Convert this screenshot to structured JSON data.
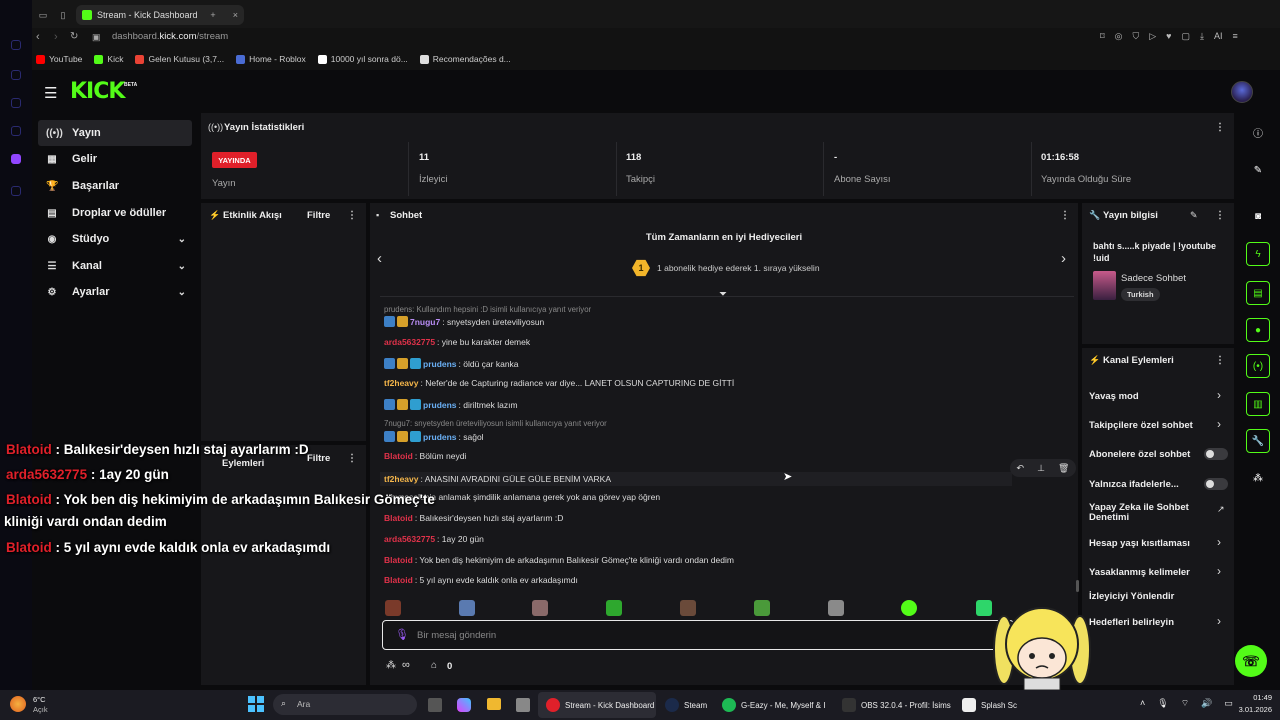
{
  "browser": {
    "tab_title": "Stream - Kick Dashboard",
    "url_prefix": "dashboard.",
    "url_domain": "kick.com",
    "url_path": "/stream",
    "ai_label": "AI",
    "bookmarks": [
      {
        "label": "YouTube",
        "icon": "youtube-icon",
        "color": "#ff0000"
      },
      {
        "label": "Kick",
        "icon": "kick-icon",
        "color": "#53fc18"
      },
      {
        "label": "Gelen Kutusu (3,7...",
        "icon": "gmail-icon",
        "color": "#ea4335"
      },
      {
        "label": "Home - Roblox",
        "icon": "roblox-icon",
        "color": "#4a6cd4"
      },
      {
        "label": "10000 yıl sonra dö...",
        "icon": "google-icon",
        "color": "#ffffff"
      },
      {
        "label": "Recomendações d...",
        "icon": "tiktok-icon",
        "color": "#dddddd"
      }
    ]
  },
  "brand": {
    "logo": "KICK",
    "beta": "BETA",
    "accent": "#53fc18"
  },
  "sidebar": {
    "items": [
      {
        "label": "Yayın",
        "icon": "broadcast-icon",
        "glyph": "((•))",
        "active": true
      },
      {
        "label": "Gelir",
        "icon": "revenue-icon",
        "glyph": "▦"
      },
      {
        "label": "Başarılar",
        "icon": "trophy-icon",
        "glyph": "🏆"
      },
      {
        "label": "Droplar ve ödüller",
        "icon": "gift-icon",
        "glyph": "▤"
      },
      {
        "label": "Stüdyo",
        "icon": "studio-icon",
        "glyph": "◉",
        "expandable": true
      },
      {
        "label": "Kanal",
        "icon": "channel-icon",
        "glyph": "☰",
        "expandable": true
      },
      {
        "label": "Ayarlar",
        "icon": "gear-icon",
        "glyph": "⚙",
        "expandable": true
      }
    ]
  },
  "stats": {
    "title": "Yayın İstatistikleri",
    "live_badge": "YAYINDA",
    "live_label": "Yayın",
    "viewers_value": "11",
    "viewers_label": "İzleyici",
    "followers_value": "118",
    "followers_label": "Takipçi",
    "subs_value": "-",
    "subs_label": "Abone Sayısı",
    "uptime_value": "01:16:58",
    "uptime_label": "Yayında Olduğu Süre"
  },
  "activity": {
    "title": "Etkinlik Akışı",
    "filter": "Filtre"
  },
  "mod_actions": {
    "title": "Eylemleri",
    "filter": "Filtre"
  },
  "chat": {
    "title": "Sohbet",
    "top_gifters_title": "Tüm Zamanların en iyi Hediyecileri",
    "top_gifters_rank": "1",
    "top_gifters_subtitle": "1 abonelik hediye ederek 1. sıraya yükselin",
    "reply1": "prudens: Kullandım hepsini :D isimli kullanıcıya yanıt veriyor",
    "reply2": "7nugu7: snyetsyden üreteviliyosun isimli kullanıcıya yanıt veriyor",
    "messages": [
      {
        "user": "7nugu7",
        "color": "#b98df5",
        "text": ": snyetsyden üreteviliyosun"
      },
      {
        "user": "arda5632775",
        "color": "#e0324a",
        "text": ": yine bu karakter demek"
      },
      {
        "user": "prudens",
        "color": "#6ab0f5",
        "text": ": öldü çar kanka"
      },
      {
        "user": "tf2heavy",
        "color": "#f5b64a",
        "text": ": Nefer'de de Capturing radiance var diye... LANET OLSUN CAPTURING DE GİTTİ"
      },
      {
        "user": "prudens",
        "color": "#6ab0f5",
        "text": ": diriltmek lazım"
      },
      {
        "user": "prudens",
        "color": "#6ab0f5",
        "text": ": sağol"
      },
      {
        "user": "Blatoid",
        "color": "#e0324a",
        "text": ": Bölüm neydi"
      },
      {
        "user": "tf2heavy",
        "color": "#f5b64a",
        "text": ": ANASINI AVRADINI GÜLE GÜLE BENİM VARKA"
      },
      {
        "user": "",
        "color": "#e0324a",
        "text": ": hyposelenia anlamak şimdilik anlamana gerek yok ana görev yap öğren"
      },
      {
        "user": "Blatoid",
        "color": "#e0324a",
        "text": ": Balıkesir'deysen hızlı staj ayarlarım :D"
      },
      {
        "user": "arda5632775",
        "color": "#e0324a",
        "text": ": 1ay 20 gün"
      },
      {
        "user": "Blatoid",
        "color": "#e0324a",
        "text": ": Yok ben diş hekimiyim de arkadaşımın Balıkesir Gömeç'te kliniği vardı ondan dedim"
      },
      {
        "user": "Blatoid",
        "color": "#e0324a",
        "text": ": 5 yıl aynı evde kaldık onla ev arkadaşımdı"
      }
    ],
    "input_placeholder": "Bir mesaj gönderin",
    "points_value": "∞",
    "shop_count": "0"
  },
  "stream_info": {
    "title": "Yayın bilgisi",
    "stream_title": "bahtı s.....k piyade | !youtube !uid",
    "category": "Sadece Sohbet",
    "language_tag": "Turkish"
  },
  "channel_actions": {
    "title": "Kanal Eylemleri",
    "items": [
      {
        "label": "Yavaş mod",
        "control": "chevron"
      },
      {
        "label": "Takipçilere özel sohbet",
        "control": "chevron"
      },
      {
        "label": "Abonelere özel sohbet",
        "control": "toggle"
      },
      {
        "label": "Yalnızca ifadelerle...",
        "control": "toggle"
      },
      {
        "label": "Yapay Zeka ile Sohbet",
        "label2": "Denetimi",
        "control": "external"
      },
      {
        "label": "Hesap yaşı kısıtlaması",
        "control": "chevron"
      },
      {
        "label": "Yasaklanmış kelimeler",
        "control": "chevron"
      },
      {
        "label": "İzleyiciyi Yönlendir",
        "control": "none"
      },
      {
        "label": "Hedefleri belirleyin",
        "control": "chevron"
      }
    ]
  },
  "overlay": {
    "lines": [
      {
        "user": "Blatoid",
        "text": " : Balıkesir'deysen hızlı staj ayarlarım :D"
      },
      {
        "user": "arda5632775",
        "text": " : 1ay 20 gün"
      },
      {
        "user": "Blatoid",
        "text": " : Yok ben diş hekimiyim de arkadaşımın Balıkesir Gömeç'te"
      },
      {
        "user": "",
        "text": "kliniği vardı ondan dedim"
      },
      {
        "user": "Blatoid",
        "text": " : 5 yıl aynı evde kaldık onla ev arkadaşımdı"
      }
    ]
  },
  "taskbar": {
    "weather_temp": "6°C",
    "weather_desc": "Açık",
    "search_placeholder": "Ara",
    "apps": [
      {
        "label": "Stream - Kick Dashboard",
        "icon": "opera-icon"
      },
      {
        "label": "Steam",
        "icon": "steam-icon"
      },
      {
        "label": "G-Eazy - Me, Myself & I",
        "icon": "spotify-icon"
      },
      {
        "label": "OBS 32.0.4 - Profil: İsims",
        "icon": "obs-icon"
      },
      {
        "label": "Splash Sc",
        "icon": "ea-icon"
      }
    ],
    "time": "01:49",
    "date": "3.01.2026"
  }
}
